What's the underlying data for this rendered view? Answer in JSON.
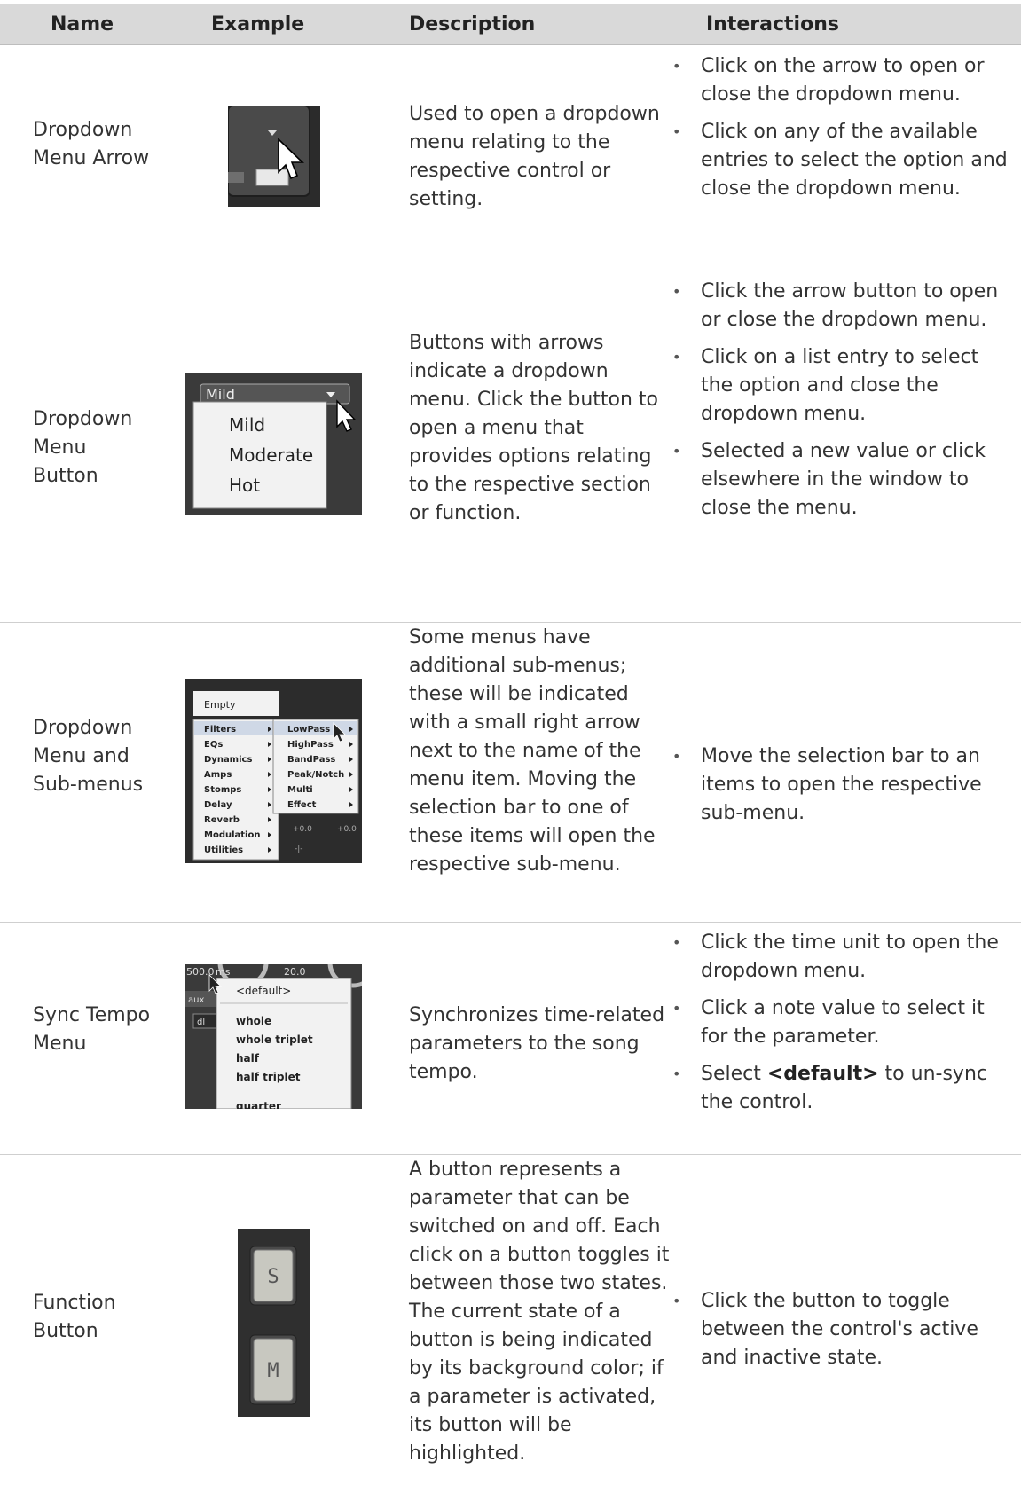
{
  "header": {
    "name": "Name",
    "example": "Example",
    "description": "Description",
    "interactions": "Interactions"
  },
  "rows": [
    {
      "name": "Dropdown Menu Arrow",
      "description": "Used to open a dropdown menu relating to the respective control or setting.",
      "interactions": [
        "Click on the arrow to open or close the dropdown menu.",
        "Click on any of the available entries to select the option and close the dropdown menu."
      ]
    },
    {
      "name": "Dropdown Menu Button",
      "description": "Buttons with arrows indicate a dropdown menu. Click the button to open a menu that provides options relating to the respective section or function.",
      "interactions": [
        "Click the arrow button to open or close the dropdown menu.",
        "Click on a list entry to select the option and close the dropdown menu.",
        "Selected a new value or click elsewhere in the window to close the menu."
      ],
      "example": {
        "current": "Mild",
        "options": [
          "Mild",
          "Moderate",
          "Hot"
        ]
      }
    },
    {
      "name": "Dropdown Menu and Sub-menus",
      "description": "Some menus have additional sub-menus; these will be indicated with a small right arrow next to the name of the menu item. Moving the selection bar to one of these items will open the respective sub-menu.",
      "interactions": [
        "Move the selection bar to an items to open the respective sub-menu."
      ],
      "example": {
        "top": "Empty",
        "menu": [
          "Filters",
          "EQs",
          "Dynamics",
          "Amps",
          "Stomps",
          "Delay",
          "Reverb",
          "Modulation",
          "Utilities"
        ],
        "submenu": [
          "LowPass",
          "HighPass",
          "BandPass",
          "Peak/Notch",
          "Multi",
          "Effect"
        ],
        "readouts": [
          "+0.0",
          "+0.0",
          "-|-"
        ]
      }
    },
    {
      "name": "Sync Tempo Menu",
      "description": "Synchronizes time-related parameters to the song tempo.",
      "interactions_a": [
        "Click the time unit to open the dropdown menu.",
        "Click a note value to select it for the parameter."
      ],
      "interaction_c": {
        "pre": "Select ",
        "bold": "<default>",
        "post": " to un-sync the control."
      },
      "example": {
        "value1": "500.0",
        "unit": "ms",
        "value2": "20.0",
        "tag1": "aux",
        "tag2": "dl",
        "default": "<default>",
        "options": [
          "whole",
          "whole triplet",
          "half",
          "half triplet",
          "quarter"
        ]
      }
    },
    {
      "name": "Function Button",
      "description": "A button represents a parameter that can be switched on and off. Each click on a button toggles it between those two states. The current state of a button is being indicated by its background color; if a parameter is activated, its button will be highlighted.",
      "interactions": [
        "Click the button to toggle between the control's active and inactive state."
      ],
      "example": {
        "btn1": "S",
        "btn2": "M"
      }
    }
  ]
}
